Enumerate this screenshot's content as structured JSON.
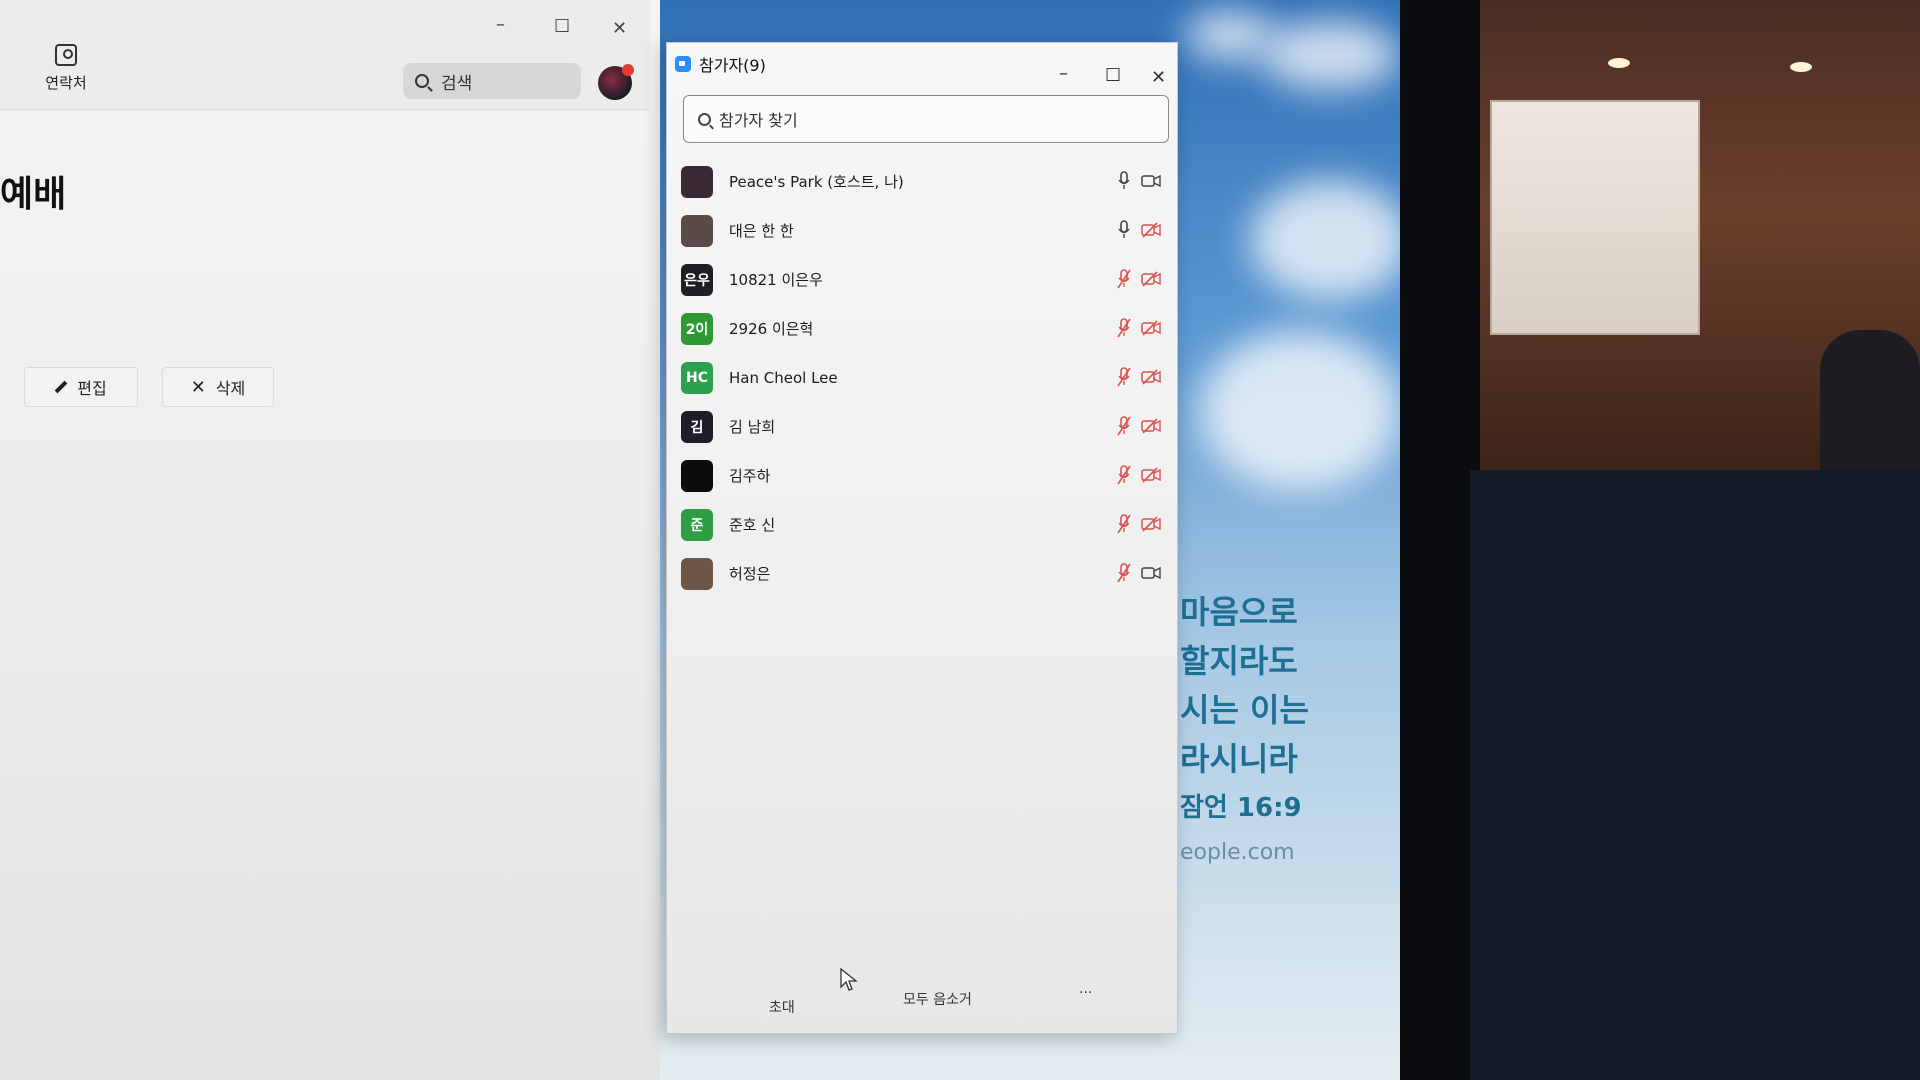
{
  "left_window": {
    "contacts_label": "연락처",
    "search_placeholder": "검색",
    "meeting_title": "예배",
    "edit_label": "편집",
    "delete_label": "삭제",
    "minimize": "–",
    "maximize": "☐",
    "close": "✕"
  },
  "participants_window": {
    "title": "참가자(9)",
    "search_placeholder": "참가자 찾기",
    "minimize": "–",
    "maximize": "☐",
    "close": "✕",
    "participants": [
      {
        "name": "Peace's Park (호스트, 나)",
        "avatar_text": "",
        "avatar_color": "#3a2a35",
        "mic": "on",
        "video": "on"
      },
      {
        "name": "대은 한 한",
        "avatar_text": "",
        "avatar_color": "#5a4a48",
        "mic": "on",
        "video": "off"
      },
      {
        "name": "10821 이은우",
        "avatar_text": "은우",
        "avatar_color": "#1e1e24",
        "mic": "muted",
        "video": "off"
      },
      {
        "name": "2926 이은혁",
        "avatar_text": "2이",
        "avatar_color": "#2f9a35",
        "mic": "muted",
        "video": "off"
      },
      {
        "name": "Han Cheol Lee",
        "avatar_text": "HC",
        "avatar_color": "#2ba14f",
        "mic": "muted",
        "video": "off"
      },
      {
        "name": "김 남희",
        "avatar_text": "김",
        "avatar_color": "#1e1e28",
        "mic": "muted",
        "video": "off"
      },
      {
        "name": "김주하",
        "avatar_text": "",
        "avatar_color": "#0c0c0e",
        "mic": "muted",
        "video": "off"
      },
      {
        "name": "준호 신",
        "avatar_text": "준",
        "avatar_color": "#2e9d43",
        "mic": "muted",
        "video": "off"
      },
      {
        "name": "허정은",
        "avatar_text": "",
        "avatar_color": "#6b5648",
        "mic": "muted",
        "video": "on"
      }
    ],
    "footer": {
      "invite_label": "초대",
      "mute_all_label": "모두 음소거",
      "more_label": "..."
    }
  },
  "wallpaper": {
    "verse_lines": [
      "마음으로",
      "할지라도",
      "시는 이는",
      "라시니라"
    ],
    "verse_ref": "잠언 16:9",
    "verse_site": "eople.com"
  },
  "colors": {
    "muted_icon": "#d9534f",
    "normal_icon": "#444444",
    "zoom_blue": "#2d8cff"
  }
}
